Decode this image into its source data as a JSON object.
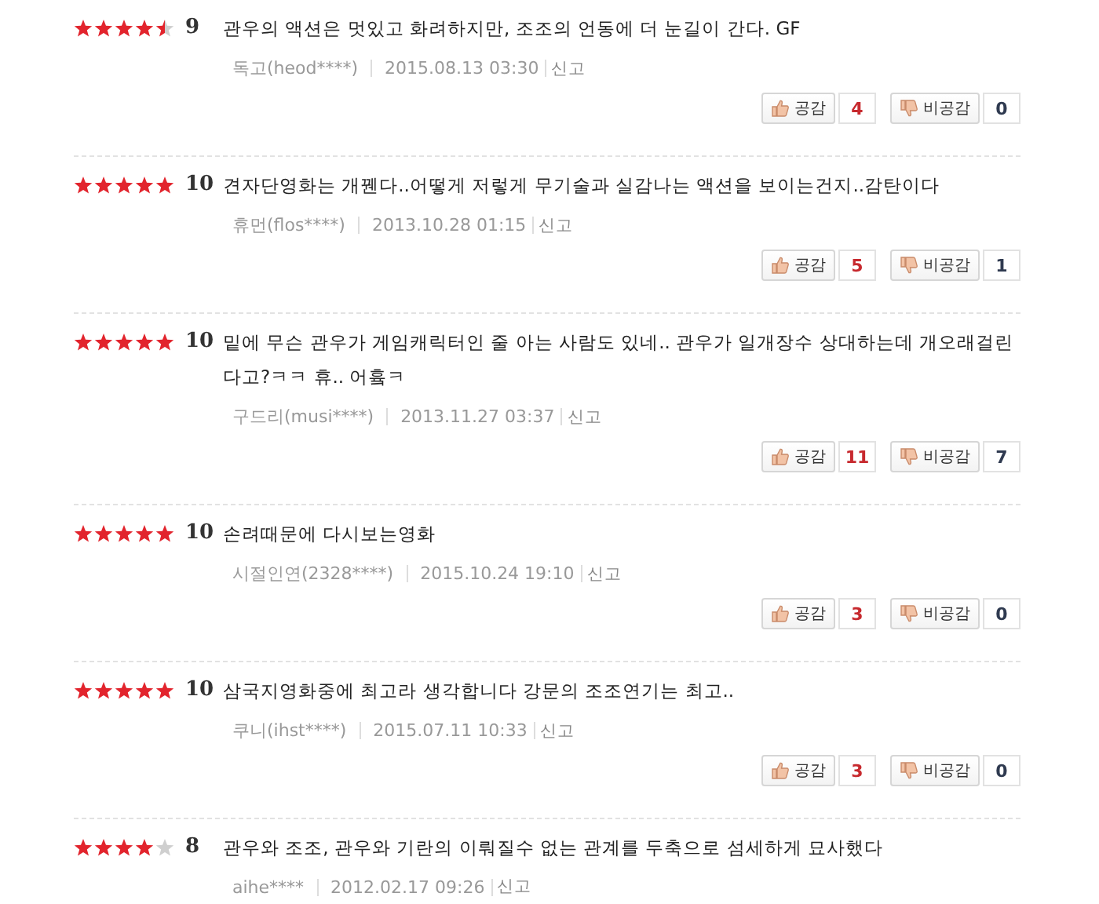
{
  "reviews": [
    {
      "stars": 4.5,
      "score": "9",
      "text": "관우의 액션은 멋있고 화려하지만, 조조의 언동에 더 눈길이 간다. GF",
      "author": "독고(heod****)",
      "date": "2015.08.13 03:30",
      "report": "신고",
      "like_label": "공감",
      "likes": "4",
      "dislike_label": "비공감",
      "dislikes": "0"
    },
    {
      "stars": 5,
      "score": "10",
      "text": "견자단영화는 개꿴다..어떻게 저렇게 무기술과 실감나는 액션을 보이는건지..감탄이다",
      "author": "휴먼(flos****)",
      "date": "2013.10.28 01:15",
      "report": "신고",
      "like_label": "공감",
      "likes": "5",
      "dislike_label": "비공감",
      "dislikes": "1"
    },
    {
      "stars": 5,
      "score": "10",
      "text": "밑에 무슨 관우가 게임캐릭터인 줄 아는 사람도 있네.. 관우가 일개장수 상대하는데 개오래걸린다고?ㅋㅋ 휴.. 어흌ㅋ",
      "author": "구드리(musi****)",
      "date": "2013.11.27 03:37",
      "report": "신고",
      "like_label": "공감",
      "likes": "11",
      "dislike_label": "비공감",
      "dislikes": "7"
    },
    {
      "stars": 5,
      "score": "10",
      "text": "손려때문에 다시보는영화",
      "author": "시절인연(2328****)",
      "date": "2015.10.24 19:10",
      "report": "신고",
      "like_label": "공감",
      "likes": "3",
      "dislike_label": "비공감",
      "dislikes": "0"
    },
    {
      "stars": 5,
      "score": "10",
      "text": "삼국지영화중에 최고라 생각합니다 강문의 조조연기는 최고..",
      "author": "쿠니(ihst****)",
      "date": "2015.07.11 10:33",
      "report": "신고",
      "like_label": "공감",
      "likes": "3",
      "dislike_label": "비공감",
      "dislikes": "0"
    },
    {
      "stars": 4,
      "score": "8",
      "text": "관우와 조조, 관우와 기란의 이뤄질수 없는 관계를 두축으로 섬세하게 묘사했다",
      "author": "aihe****",
      "date": "2012.02.17 09:26",
      "report": "신고"
    }
  ]
}
